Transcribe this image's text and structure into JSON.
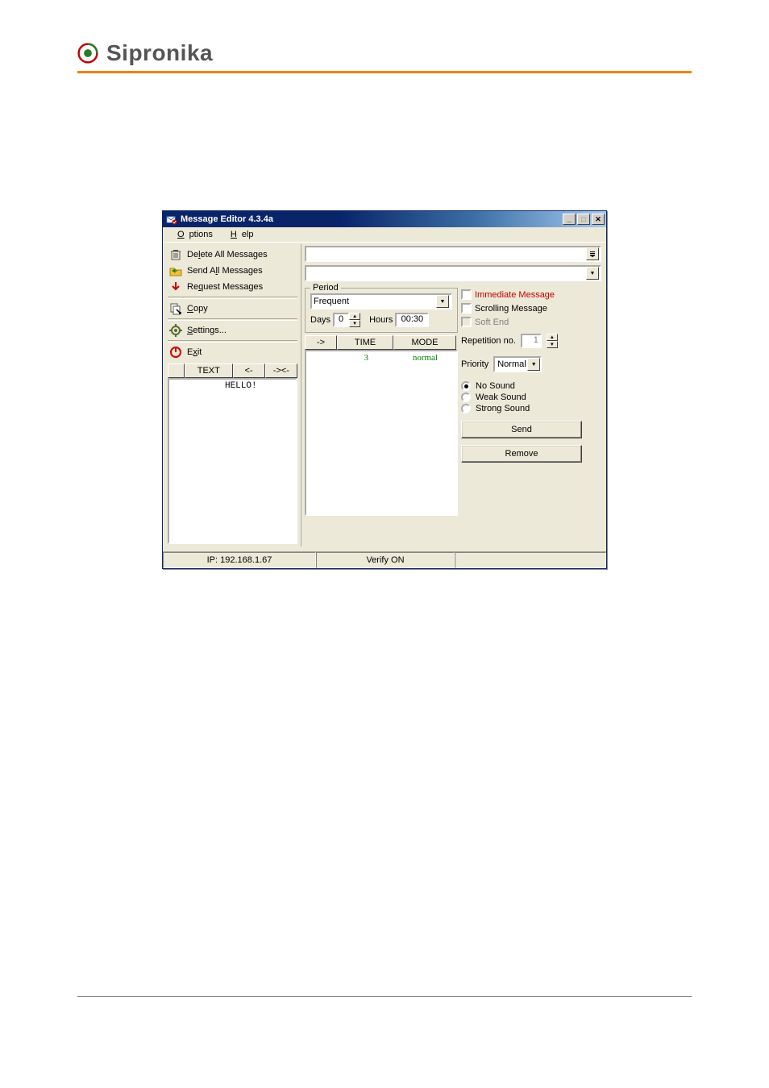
{
  "brand": {
    "name": "Sipronika"
  },
  "window": {
    "title": "Message Editor 4.3.4a",
    "menubar": {
      "options": "Options",
      "options_ul": "O",
      "help": "Help",
      "help_ul": "H"
    }
  },
  "sidebar": {
    "delete_all": "Delete All Messages",
    "delete_ul": "l",
    "send_all": "Send All Messages",
    "send_ul": "l",
    "request": "Request Messages",
    "request_ul": "q",
    "copy": "Copy",
    "copy_ul": "C",
    "settings": "Settings...",
    "settings_ul": "S",
    "exit": "Exit",
    "exit_ul": "x"
  },
  "period": {
    "legend": "Period",
    "type": "Frequent",
    "days_label": "Days",
    "days_value": "0",
    "hours_label": "Hours",
    "hours_value": "00:30"
  },
  "flags": {
    "immediate": "Immediate Message",
    "scrolling": "Scrolling Message",
    "soft_end": "Soft End"
  },
  "left_table": {
    "headers": {
      "text": "TEXT",
      "left": "<-",
      "center": "-><-"
    },
    "row": {
      "text": "HELLO!"
    }
  },
  "mid_table": {
    "headers": {
      "right": "->",
      "time": "TIME",
      "mode": "MODE"
    },
    "row": {
      "time": "3",
      "mode": "normal"
    }
  },
  "form": {
    "rep_label": "Repetition no.",
    "rep_value": "1",
    "priority_label": "Priority",
    "priority_value": "Normal",
    "sound": {
      "none": "No Sound",
      "weak": "Weak Sound",
      "strong": "Strong Sound"
    },
    "send_btn": "Send",
    "remove_btn": "Remove"
  },
  "status": {
    "ip": "IP: 192.168.1.67",
    "verify": "Verify ON"
  }
}
